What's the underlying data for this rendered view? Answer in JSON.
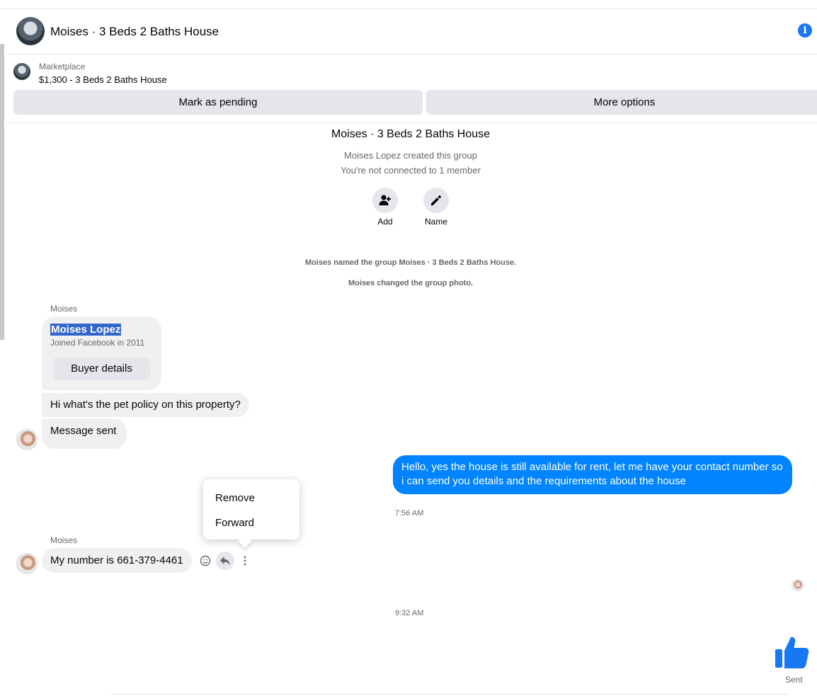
{
  "header": {
    "title": "Moises · 3 Beds 2 Baths House"
  },
  "marketplace": {
    "label": "Marketplace",
    "item": "$1,300 - 3 Beds 2 Baths House",
    "mark_pending": "Mark as pending",
    "more_options": "More options"
  },
  "group": {
    "title": "Moises · 3 Beds 2 Baths House",
    "created": "Moises Lopez created this group",
    "connection": "You're not connected to 1 member",
    "add_label": "Add",
    "name_label": "Name"
  },
  "system": {
    "named": "Moises named the group Moises · 3 Beds 2 Baths House.",
    "photo": "Moises changed the group photo."
  },
  "thread": {
    "sender1": "Moises",
    "card_name": "Moises Lopez",
    "card_joined": "Joined Facebook in 2011",
    "card_button": "Buyer details",
    "msg1": "Hi what's the pet policy on this property?",
    "msg2": "Message sent",
    "out_msg": "Hello, yes the house is still available for rent, let me have your contact number so i can send you details and the requirements about the house",
    "time1": "7:56 AM",
    "sender2": "Moises",
    "msg3": "My number is 661-379-4461",
    "time2": "9:32 AM",
    "sent_status": "Sent"
  },
  "context_menu": {
    "remove": "Remove",
    "forward": "Forward"
  },
  "colors": {
    "accent": "#0084ff",
    "like": "#1877f2",
    "bubble_in": "#f0f0f0"
  }
}
